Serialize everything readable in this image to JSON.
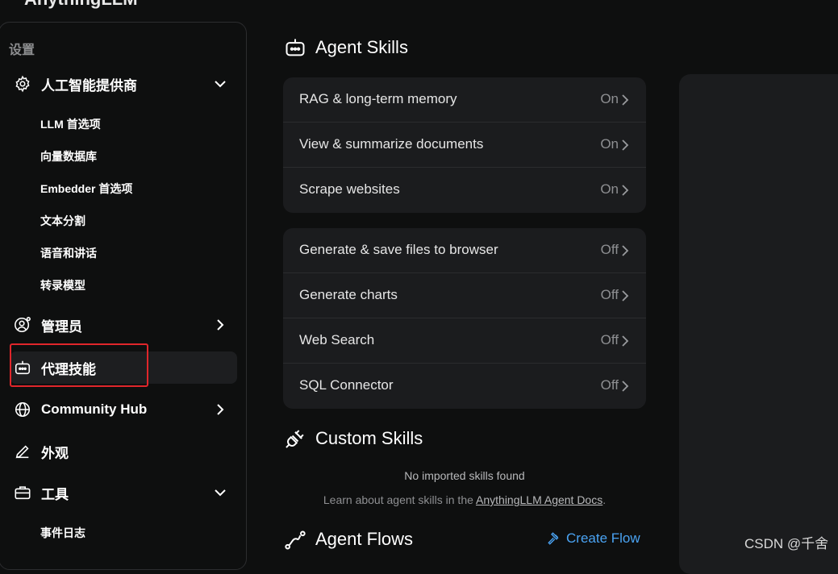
{
  "app": {
    "title_partial": "AnythingLLM"
  },
  "sidebar": {
    "heading": "设置",
    "items": [
      {
        "label": "人工智能提供商",
        "icon": "gear-icon",
        "chevron": "down"
      },
      {
        "label": "管理员",
        "icon": "user-gear-icon",
        "chevron": "right"
      },
      {
        "label": "代理技能",
        "icon": "robot-icon",
        "chevron": "none",
        "active": true
      },
      {
        "label": "Community Hub",
        "icon": "globe-icon",
        "chevron": "right"
      },
      {
        "label": "外观",
        "icon": "pencil-icon",
        "chevron": "none"
      },
      {
        "label": "工具",
        "icon": "toolbox-icon",
        "chevron": "down"
      }
    ],
    "provider_sub_items": [
      "LLM 首选项",
      "向量数据库",
      "Embedder 首选项",
      "文本分割",
      "语音和讲话",
      "转录模型"
    ],
    "tools_sub_items": [
      "事件日志"
    ]
  },
  "main": {
    "agent_skills_title": "Agent Skills",
    "default_skills": [
      {
        "name": "RAG & long-term memory",
        "state": "On"
      },
      {
        "name": "View & summarize documents",
        "state": "On"
      },
      {
        "name": "Scrape websites",
        "state": "On"
      }
    ],
    "configurable_skills": [
      {
        "name": "Generate & save files to browser",
        "state": "Off"
      },
      {
        "name": "Generate charts",
        "state": "Off"
      },
      {
        "name": "Web Search",
        "state": "Off"
      },
      {
        "name": "SQL Connector",
        "state": "Off"
      }
    ],
    "custom_skills_title": "Custom Skills",
    "no_skills_text": "No imported skills found",
    "learn_prefix": "Learn about agent skills in the ",
    "learn_link": "AnythingLLM Agent Docs",
    "learn_suffix": ".",
    "agent_flows_title": "Agent Flows",
    "create_flow_label": "Create Flow"
  },
  "watermark": "CSDN @千舍",
  "colors": {
    "background": "#0e0f0f",
    "card": "#1b1c1e",
    "link": "#4aa3f3",
    "highlight": "#e0262b"
  }
}
